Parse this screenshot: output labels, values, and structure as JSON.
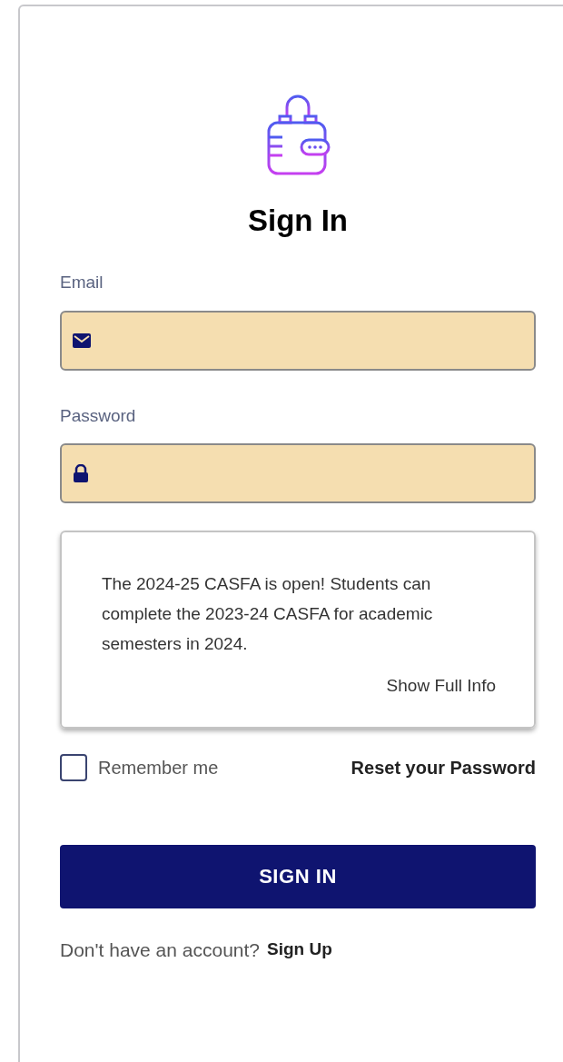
{
  "title": "Sign In",
  "fields": [
    {
      "label": "Email",
      "kind": "email"
    },
    {
      "label": "Password",
      "kind": "password"
    }
  ],
  "notice": {
    "text": "The 2024-25 CASFA is open! Students can complete the 2023-24 CASFA for academic semesters in 2024.",
    "link": "Show Full Info"
  },
  "remember": {
    "label": "Remember me",
    "checked": false
  },
  "reset_link": "Reset your Password",
  "submit": "SIGN IN",
  "footer": {
    "text": "Don't have an account?",
    "link": "Sign Up"
  }
}
